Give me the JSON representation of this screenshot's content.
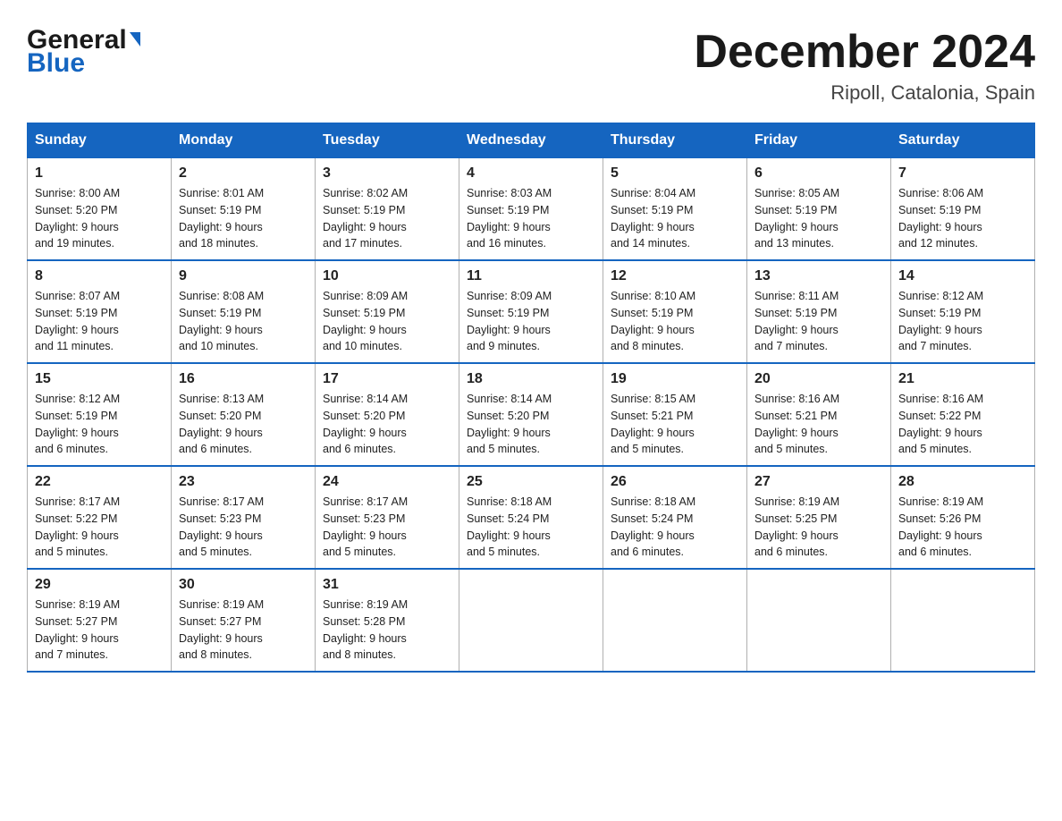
{
  "logo": {
    "line1_black": "General",
    "line1_blue": "Blue",
    "line2": "Blue"
  },
  "header": {
    "title": "December 2024",
    "subtitle": "Ripoll, Catalonia, Spain"
  },
  "columns": [
    "Sunday",
    "Monday",
    "Tuesday",
    "Wednesday",
    "Thursday",
    "Friday",
    "Saturday"
  ],
  "weeks": [
    [
      {
        "day": "1",
        "sunrise": "8:00 AM",
        "sunset": "5:20 PM",
        "daylight": "9 hours and 19 minutes."
      },
      {
        "day": "2",
        "sunrise": "8:01 AM",
        "sunset": "5:19 PM",
        "daylight": "9 hours and 18 minutes."
      },
      {
        "day": "3",
        "sunrise": "8:02 AM",
        "sunset": "5:19 PM",
        "daylight": "9 hours and 17 minutes."
      },
      {
        "day": "4",
        "sunrise": "8:03 AM",
        "sunset": "5:19 PM",
        "daylight": "9 hours and 16 minutes."
      },
      {
        "day": "5",
        "sunrise": "8:04 AM",
        "sunset": "5:19 PM",
        "daylight": "9 hours and 14 minutes."
      },
      {
        "day": "6",
        "sunrise": "8:05 AM",
        "sunset": "5:19 PM",
        "daylight": "9 hours and 13 minutes."
      },
      {
        "day": "7",
        "sunrise": "8:06 AM",
        "sunset": "5:19 PM",
        "daylight": "9 hours and 12 minutes."
      }
    ],
    [
      {
        "day": "8",
        "sunrise": "8:07 AM",
        "sunset": "5:19 PM",
        "daylight": "9 hours and 11 minutes."
      },
      {
        "day": "9",
        "sunrise": "8:08 AM",
        "sunset": "5:19 PM",
        "daylight": "9 hours and 10 minutes."
      },
      {
        "day": "10",
        "sunrise": "8:09 AM",
        "sunset": "5:19 PM",
        "daylight": "9 hours and 10 minutes."
      },
      {
        "day": "11",
        "sunrise": "8:09 AM",
        "sunset": "5:19 PM",
        "daylight": "9 hours and 9 minutes."
      },
      {
        "day": "12",
        "sunrise": "8:10 AM",
        "sunset": "5:19 PM",
        "daylight": "9 hours and 8 minutes."
      },
      {
        "day": "13",
        "sunrise": "8:11 AM",
        "sunset": "5:19 PM",
        "daylight": "9 hours and 7 minutes."
      },
      {
        "day": "14",
        "sunrise": "8:12 AM",
        "sunset": "5:19 PM",
        "daylight": "9 hours and 7 minutes."
      }
    ],
    [
      {
        "day": "15",
        "sunrise": "8:12 AM",
        "sunset": "5:19 PM",
        "daylight": "9 hours and 6 minutes."
      },
      {
        "day": "16",
        "sunrise": "8:13 AM",
        "sunset": "5:20 PM",
        "daylight": "9 hours and 6 minutes."
      },
      {
        "day": "17",
        "sunrise": "8:14 AM",
        "sunset": "5:20 PM",
        "daylight": "9 hours and 6 minutes."
      },
      {
        "day": "18",
        "sunrise": "8:14 AM",
        "sunset": "5:20 PM",
        "daylight": "9 hours and 5 minutes."
      },
      {
        "day": "19",
        "sunrise": "8:15 AM",
        "sunset": "5:21 PM",
        "daylight": "9 hours and 5 minutes."
      },
      {
        "day": "20",
        "sunrise": "8:16 AM",
        "sunset": "5:21 PM",
        "daylight": "9 hours and 5 minutes."
      },
      {
        "day": "21",
        "sunrise": "8:16 AM",
        "sunset": "5:22 PM",
        "daylight": "9 hours and 5 minutes."
      }
    ],
    [
      {
        "day": "22",
        "sunrise": "8:17 AM",
        "sunset": "5:22 PM",
        "daylight": "9 hours and 5 minutes."
      },
      {
        "day": "23",
        "sunrise": "8:17 AM",
        "sunset": "5:23 PM",
        "daylight": "9 hours and 5 minutes."
      },
      {
        "day": "24",
        "sunrise": "8:17 AM",
        "sunset": "5:23 PM",
        "daylight": "9 hours and 5 minutes."
      },
      {
        "day": "25",
        "sunrise": "8:18 AM",
        "sunset": "5:24 PM",
        "daylight": "9 hours and 5 minutes."
      },
      {
        "day": "26",
        "sunrise": "8:18 AM",
        "sunset": "5:24 PM",
        "daylight": "9 hours and 6 minutes."
      },
      {
        "day": "27",
        "sunrise": "8:19 AM",
        "sunset": "5:25 PM",
        "daylight": "9 hours and 6 minutes."
      },
      {
        "day": "28",
        "sunrise": "8:19 AM",
        "sunset": "5:26 PM",
        "daylight": "9 hours and 6 minutes."
      }
    ],
    [
      {
        "day": "29",
        "sunrise": "8:19 AM",
        "sunset": "5:27 PM",
        "daylight": "9 hours and 7 minutes."
      },
      {
        "day": "30",
        "sunrise": "8:19 AM",
        "sunset": "5:27 PM",
        "daylight": "9 hours and 8 minutes."
      },
      {
        "day": "31",
        "sunrise": "8:19 AM",
        "sunset": "5:28 PM",
        "daylight": "9 hours and 8 minutes."
      },
      null,
      null,
      null,
      null
    ]
  ],
  "labels": {
    "sunrise": "Sunrise:",
    "sunset": "Sunset:",
    "daylight": "Daylight:"
  }
}
